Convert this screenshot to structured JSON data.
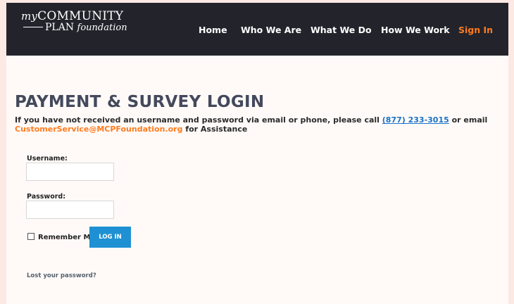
{
  "logo": {
    "prefix": "my",
    "line1": "COMMUNITY",
    "line2": "PLAN",
    "suffix": "foundation"
  },
  "nav": {
    "home": "Home",
    "who": "Who We Are",
    "what": "What We Do",
    "how": "How We Work",
    "signin": "Sign In"
  },
  "page": {
    "title": "PAYMENT & SURVEY LOGIN",
    "notice_pre": "If you have not received an username and password via email or phone, please call ",
    "phone": "(877) 233-3015",
    "notice_mid": " or email ",
    "email": "CustomerService@MCPFoundation.org",
    "notice_post": " for Assistance"
  },
  "form": {
    "username_label": "Username:",
    "username_value": "",
    "password_label": "Password:",
    "password_value": "",
    "remember_label": "Remember Me",
    "login_button": "LOG IN",
    "lost_password": "Lost your password?"
  },
  "colors": {
    "header_bg": "#23242b",
    "accent_orange": "#ff7b1d",
    "link_blue": "#1a73c8",
    "button_blue": "#1f90d3",
    "page_bg": "#fce9e4"
  }
}
